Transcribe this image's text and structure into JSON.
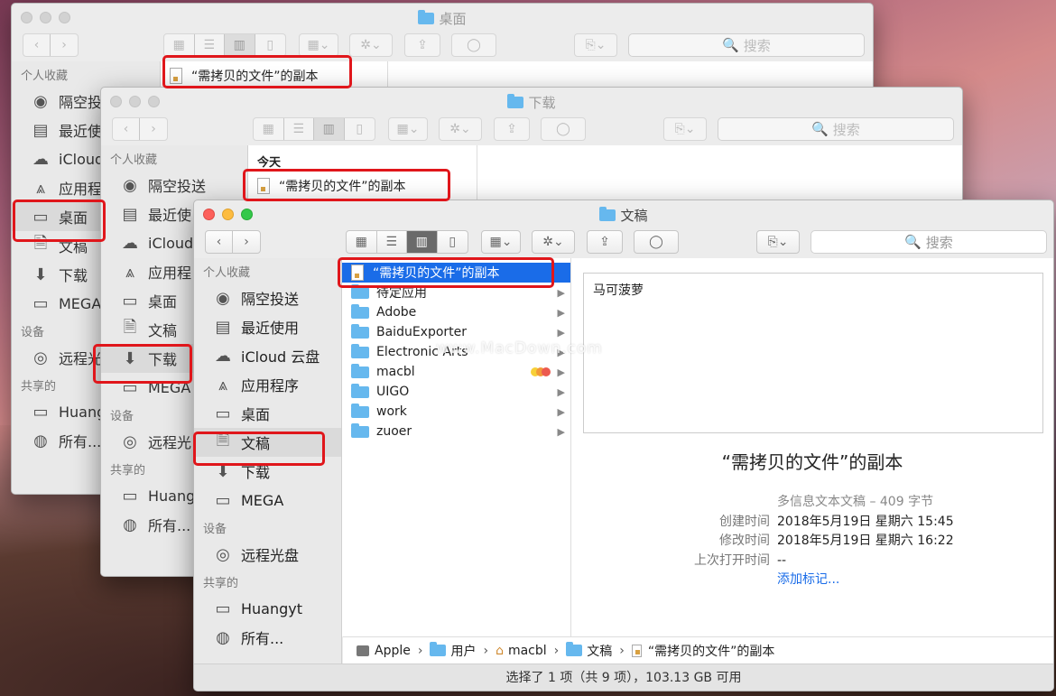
{
  "windows": {
    "desktop": {
      "title": "桌面",
      "search": "搜索",
      "sidebar": {
        "favorites_header": "个人收藏",
        "items": [
          "隔空投",
          "最近使",
          "iCloud",
          "应用程",
          "桌面",
          "文稿",
          "下载",
          "MEGA"
        ],
        "devices_header": "设备",
        "devices": [
          "远程光"
        ],
        "shared_header": "共享的",
        "shared": [
          "Huang",
          "所有..."
        ]
      },
      "file": "“需拷贝的文件”的副本"
    },
    "downloads": {
      "title": "下载",
      "search": "搜索",
      "sidebar": {
        "favorites_header": "个人收藏",
        "items": [
          "隔空投送",
          "最近使",
          "iCloud",
          "应用程",
          "桌面",
          "文稿",
          "下载",
          "MEGA"
        ],
        "devices_header": "设备",
        "devices": [
          "远程光"
        ],
        "shared_header": "共享的",
        "shared": [
          "Huang",
          "所有..."
        ]
      },
      "group_header": "今天",
      "file": "“需拷贝的文件”的副本"
    },
    "documents": {
      "title": "文稿",
      "search": "搜索",
      "sidebar": {
        "favorites_header": "个人收藏",
        "items": [
          "隔空投送",
          "最近使用",
          "iCloud 云盘",
          "应用程序",
          "桌面",
          "文稿",
          "下载",
          "MEGA"
        ],
        "devices_header": "设备",
        "devices": [
          "远程光盘"
        ],
        "shared_header": "共享的",
        "shared": [
          "Huangyt",
          "所有..."
        ]
      },
      "files": [
        "“需拷贝的文件”的副本",
        "待定应用",
        "Adobe",
        "BaiduExporter",
        "Electronic Arts",
        "macbl",
        "UIGO",
        "work",
        "zuoer"
      ],
      "preview_text": "马可菠萝",
      "info": {
        "name": "“需拷贝的文件”的副本",
        "kind": "多信息文本文稿 – 409 字节",
        "created_label": "创建时间",
        "created": "2018年5月19日 星期六 15:45",
        "modified_label": "修改时间",
        "modified": "2018年5月19日 星期六 16:22",
        "opened_label": "上次打开时间",
        "opened": "--",
        "add_tags": "添加标记..."
      },
      "path": [
        "Apple",
        "用户",
        "macbl",
        "文稿",
        "“需拷贝的文件”的副本"
      ],
      "status": "选择了 1 项（共 9 项），103.13 GB 可用"
    }
  },
  "watermark": "www.MacDown.com",
  "colors": {
    "selection": "#1a6ce8",
    "highlight_box": "#e0161b"
  }
}
